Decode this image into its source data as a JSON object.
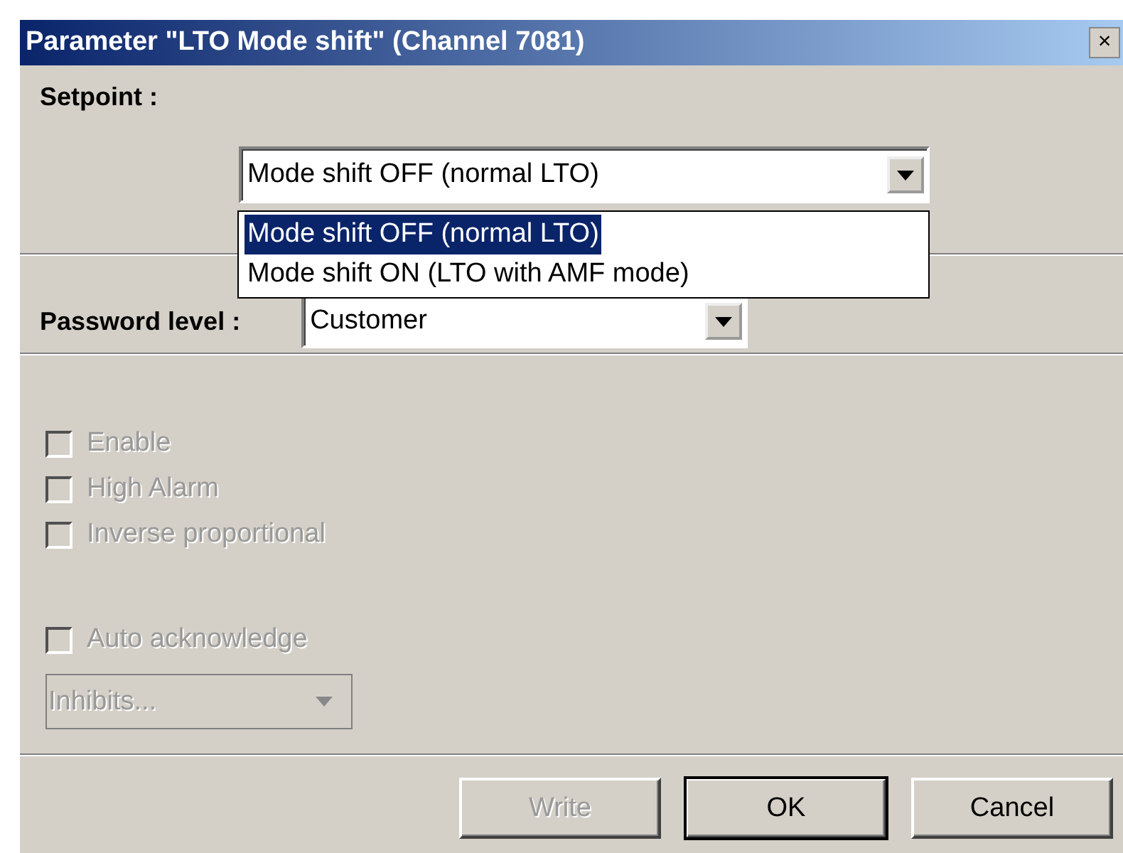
{
  "window": {
    "title": "Parameter \"LTO Mode shift\" (Channel 7081)",
    "close": "×"
  },
  "setpoint": {
    "label": "Setpoint :",
    "value": "Mode shift OFF (normal LTO)",
    "expanded": true,
    "options": [
      {
        "label": "Mode shift OFF (normal LTO)",
        "selected": true
      },
      {
        "label": "Mode shift ON (LTO with AMF mode)",
        "selected": false
      }
    ]
  },
  "password_level": {
    "label": "Password level :",
    "value": "Customer"
  },
  "checkboxes": [
    {
      "label": "Enable",
      "checked": false,
      "disabled": true
    },
    {
      "label": "High Alarm",
      "checked": false,
      "disabled": true
    },
    {
      "label": "Inverse proportional",
      "checked": false,
      "disabled": true
    },
    {
      "label": "Auto acknowledge",
      "checked": false,
      "disabled": true
    }
  ],
  "inhibits": {
    "value": "Inhibits...",
    "disabled": true
  },
  "buttons": [
    {
      "label": "Write",
      "disabled": true,
      "default": false
    },
    {
      "label": "OK",
      "disabled": false,
      "default": true
    },
    {
      "label": "Cancel",
      "disabled": false,
      "default": false
    }
  ]
}
